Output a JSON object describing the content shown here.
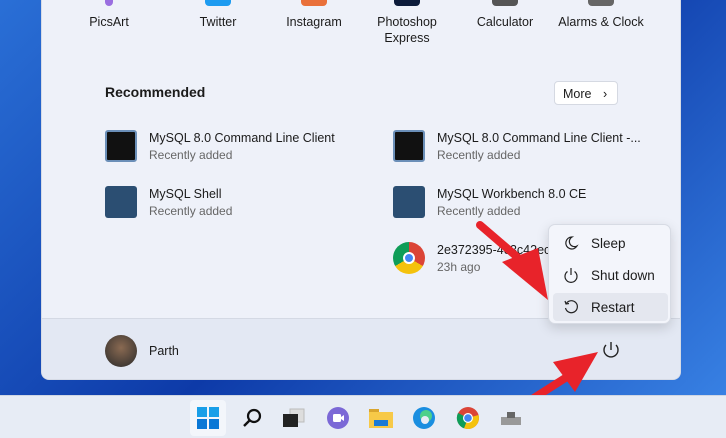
{
  "pinned": [
    {
      "label": "PicsArt"
    },
    {
      "label": "Twitter"
    },
    {
      "label": "Instagram"
    },
    {
      "label": "Photoshop",
      "label2": "Express"
    },
    {
      "label": "Calculator"
    },
    {
      "label": "Alarms & Clock"
    }
  ],
  "recommended": {
    "title": "Recommended",
    "more_label": "More",
    "chevron": "›",
    "items": [
      {
        "name": "MySQL 8.0 Command Line Client",
        "sub": "Recently added"
      },
      {
        "name": "MySQL 8.0 Command Line Client -...",
        "sub": "Recently added"
      },
      {
        "name": "MySQL Shell",
        "sub": "Recently added"
      },
      {
        "name": "MySQL Workbench 8.0 CE",
        "sub": "Recently added"
      },
      {
        "name": "2e372395-4c3c42ec",
        "sub": "23h ago"
      }
    ]
  },
  "user": {
    "name": "Parth"
  },
  "power_menu": {
    "items": [
      {
        "label": "Sleep"
      },
      {
        "label": "Shut down"
      },
      {
        "label": "Restart"
      }
    ]
  },
  "colors": {
    "accent": "#0067c0",
    "arrow": "#e8232a"
  }
}
